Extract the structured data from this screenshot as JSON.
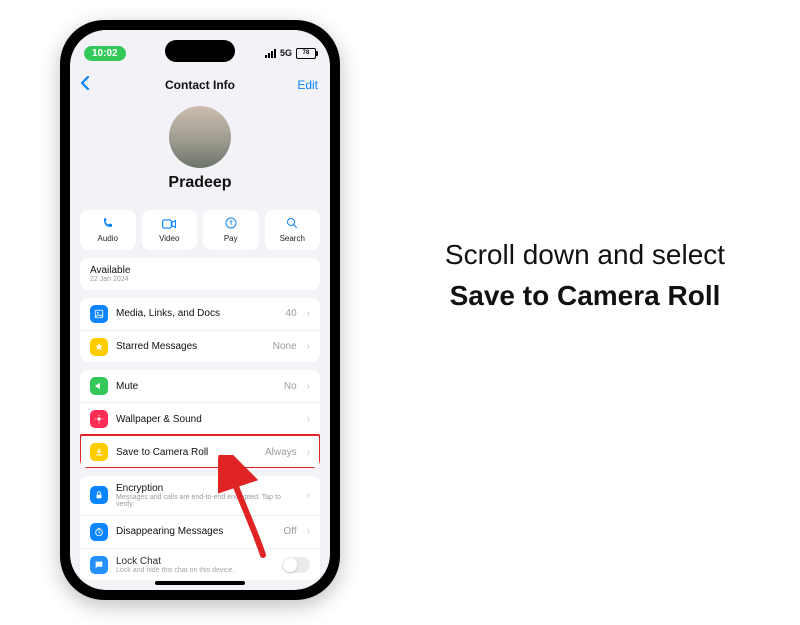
{
  "status": {
    "time": "10:02",
    "network": "5G",
    "battery": "78"
  },
  "navbar": {
    "title": "Contact Info",
    "edit": "Edit"
  },
  "profile": {
    "name": "Pradeep",
    "subtitle": ""
  },
  "actions": {
    "audio": "Audio",
    "video": "Video",
    "pay": "Pay",
    "search": "Search"
  },
  "status_card": {
    "title": "Available",
    "date": "22 Jan 2024"
  },
  "media": {
    "label": "Media, Links, and Docs",
    "count": "40"
  },
  "starred": {
    "label": "Starred Messages",
    "value": "None"
  },
  "mute": {
    "label": "Mute",
    "value": "No"
  },
  "wallpaper": {
    "label": "Wallpaper & Sound"
  },
  "save": {
    "label": "Save to Camera Roll",
    "value": "Always"
  },
  "encryption": {
    "label": "Encryption",
    "sub": "Messages and calls are end-to-end encrypted. Tap to verify."
  },
  "disappearing": {
    "label": "Disappearing Messages",
    "value": "Off"
  },
  "lockchat": {
    "label": "Lock Chat",
    "sub": "Lock and hide this chat on this device."
  },
  "instruction": {
    "pre": "Scroll down and select ",
    "bold": "Save to Camera Roll"
  }
}
